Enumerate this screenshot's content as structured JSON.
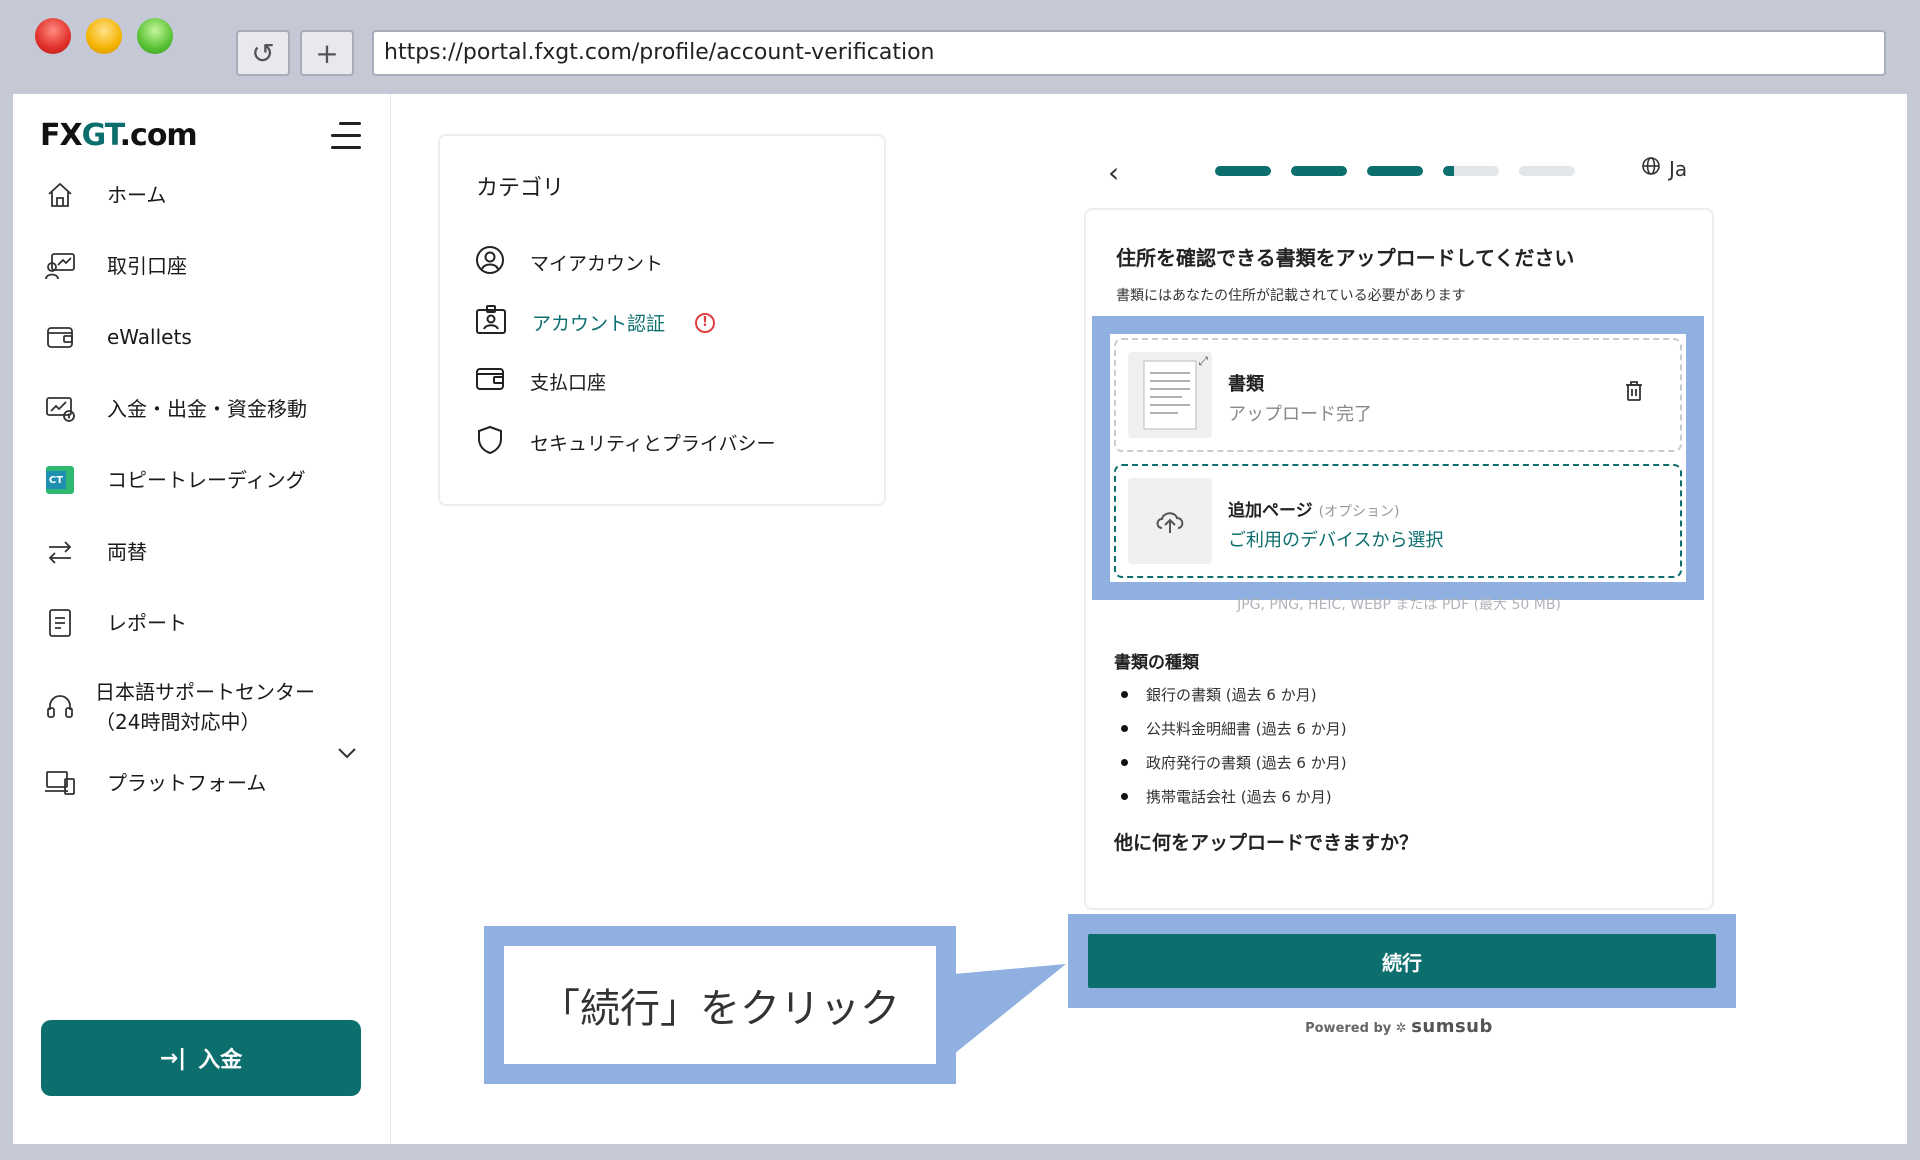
{
  "browser": {
    "url": "https://portal.fxgt.com/profile/account-verification",
    "reload_glyph": "↺",
    "newtab_glyph": "+"
  },
  "sidebar": {
    "logo_main": "FX",
    "logo_gt": "GT",
    "logo_suffix": ".com",
    "items": [
      {
        "label": "ホーム",
        "icon": "home-icon"
      },
      {
        "label": "取引口座",
        "icon": "trading-account-icon"
      },
      {
        "label": "eWallets",
        "icon": "wallet-icon"
      },
      {
        "label": "入金・出金・資金移動",
        "icon": "funds-icon"
      },
      {
        "label": "コピートレーディング",
        "icon": "copy-trading-icon"
      },
      {
        "label": "両替",
        "icon": "exchange-icon"
      },
      {
        "label": "レポート",
        "icon": "report-icon"
      },
      {
        "label": "日本語サポートセンター\n（24時間対応中）",
        "icon": "headset-icon"
      },
      {
        "label": "プラットフォーム",
        "icon": "platform-icon"
      }
    ],
    "copy_badge": "CT",
    "deposit_label": "入金",
    "deposit_glyph": "→|"
  },
  "category": {
    "title": "カテゴリ",
    "items": [
      {
        "label": "マイアカウント",
        "icon": "user-circle-icon"
      },
      {
        "label": "アカウント認証",
        "icon": "id-card-icon"
      },
      {
        "label": "支払口座",
        "icon": "wallet-icon"
      },
      {
        "label": "セキュリティとプライバシー",
        "icon": "shield-icon"
      }
    ],
    "warn_glyph": "!"
  },
  "verification": {
    "back_glyph": "‹",
    "progress": {
      "total_steps": 5,
      "completed_steps": 3,
      "current_step_fraction": 0.2
    },
    "language": "Ja",
    "title": "住所を確認できる書類をアップロードしてください",
    "subtitle": "書類にはあなたの住所が記載されている必要があります",
    "document": {
      "name": "書類",
      "status": "アップロード完了"
    },
    "additional": {
      "name": "追加ページ",
      "optional": "(オプション)",
      "link": "ご利用のデバイスから選択"
    },
    "formats": "JPG, PNG, HEIC, WEBP または PDF (最大 50 MB)",
    "types_title": "書類の種類",
    "types": [
      "銀行の書類 (過去 6 か月)",
      "公共料金明細書 (過去 6 か月)",
      "政府発行の書類 (過去 6 か月)",
      "携帯電話会社 (過去 6 か月)"
    ],
    "other_question": "他に何をアップロードできますか？",
    "continue_label": "続行",
    "powered_by": "Powered by",
    "powered_brand": "sumsub"
  },
  "callout": {
    "text": "「続行」をクリック"
  },
  "colors": {
    "brand": "#0d6e6e",
    "highlight": "#8fb0e0",
    "warning": "#e04040"
  }
}
